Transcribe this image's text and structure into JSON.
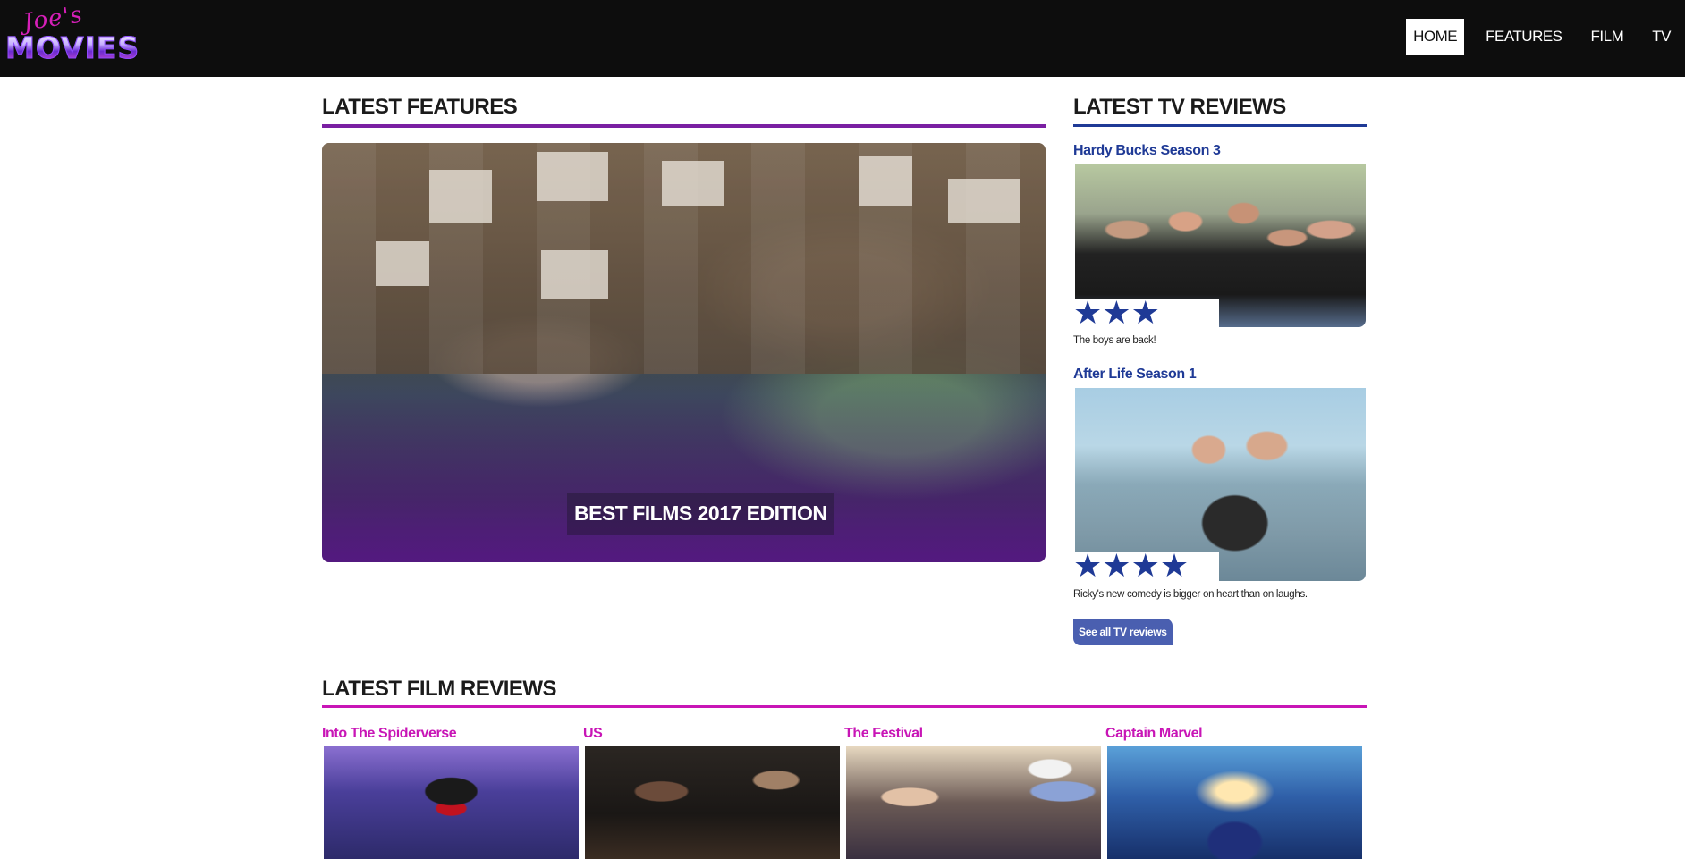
{
  "brand": {
    "script": "Joe's",
    "word": "MOVIES"
  },
  "nav": [
    {
      "label": "HOME",
      "active": true
    },
    {
      "label": "FEATURES",
      "active": false
    },
    {
      "label": "FILM",
      "active": false
    },
    {
      "label": "TV",
      "active": false
    }
  ],
  "features": {
    "heading": "LATEST FEATURES",
    "items": [
      {
        "caption": "BEST FILMS 2017 EDITION"
      }
    ]
  },
  "tv": {
    "heading": "LATEST TV REVIEWS",
    "reviews": [
      {
        "title": "Hardy Bucks Season 3",
        "stars": 3,
        "blurb": "The boys are back!"
      },
      {
        "title": "After Life Season 1",
        "stars": 4,
        "blurb": "Ricky's new comedy is bigger on heart than on laughs."
      }
    ],
    "see_all_label": "See all TV reviews"
  },
  "film": {
    "heading": "LATEST FILM REVIEWS",
    "reviews": [
      {
        "title": "Into The Spiderverse"
      },
      {
        "title": "US"
      },
      {
        "title": "The Festival"
      },
      {
        "title": "Captain Marvel"
      }
    ]
  },
  "colors": {
    "header_bg": "#0d0d0d",
    "features_accent": "#7a1fa2",
    "tv_accent": "#1f3a96",
    "film_accent": "#c815b6",
    "button_bg": "#4a5fb0"
  }
}
